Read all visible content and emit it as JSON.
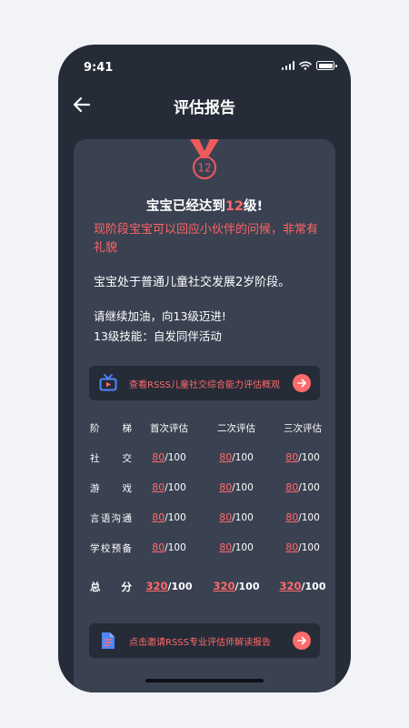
{
  "status": {
    "time": "9:41"
  },
  "nav": {
    "title": "评估报告",
    "back_icon": "arrow-left-icon"
  },
  "card": {
    "medal_level": "12",
    "headline_prefix": "宝宝已经达到",
    "headline_level": "12",
    "headline_suffix": "级!",
    "highlight": "现阶段宝宝可以回应小伙伴的问候，非常有礼貌",
    "stage_text": "宝宝处于普通儿童社交发展2岁阶段。",
    "encourage_text": "请继续加油，向13级迈进!",
    "skill_text": "13级技能：自发同伴活动",
    "banner_top": {
      "icon": "tv-icon",
      "text": "查看RSSS儿童社交综合能力评估概观"
    },
    "banner_bottom": {
      "icon": "document-icon",
      "text": "点击邀请RSSS专业评估师解读报告"
    },
    "table": {
      "headers": [
        "阶梯",
        "首次评估",
        "二次评估",
        "三次评估"
      ],
      "rows": [
        {
          "label": "社交",
          "scores": [
            "80",
            "80",
            "80"
          ],
          "max": "/100"
        },
        {
          "label": "游戏",
          "scores": [
            "80",
            "80",
            "80"
          ],
          "max": "/100"
        },
        {
          "label": "言语沟通",
          "scores": [
            "80",
            "80",
            "80"
          ],
          "max": "/100"
        },
        {
          "label": "学校预备",
          "scores": [
            "80",
            "80",
            "80"
          ],
          "max": "/100"
        }
      ],
      "total": {
        "label": "总分",
        "scores": [
          "320",
          "320",
          "320"
        ],
        "max": "/100"
      }
    }
  },
  "colors": {
    "background": "#262b38",
    "card": "#3a4151",
    "accent": "#ff6a6a",
    "icon_blue": "#4f86ff"
  }
}
